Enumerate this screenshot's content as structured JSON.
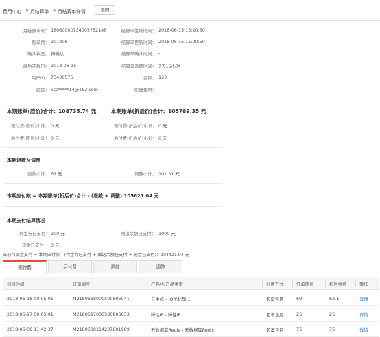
{
  "breadcrumb": {
    "home": "费用中心",
    "sep": ">",
    "level2": "月结算单",
    "level3": "月结算单详情"
  },
  "back_label": "返回",
  "info": {
    "bill_no_label": "月结算单号：",
    "bill_no": "18060000734005752146",
    "gen_time_label": "结算单生成时间：",
    "gen_time": "2018-06-15 15:20:50",
    "period_label": "账单月：",
    "period": "201806",
    "update_time_label": "结算单更新时间：",
    "update_time": "2018-06-15 15:20:50",
    "confirm_status_label": "确认状态：",
    "confirm_status": "待确认",
    "confirm_time_label": "结算单确认时间：",
    "confirm_time": "-",
    "due_date_label": "最后还款日：",
    "due_date": "2018-06-15",
    "overdue_label": "结算单逾期时间：",
    "overdue": "7天15小时",
    "user_id_label": "用户ID：",
    "user_id": "73400575",
    "name_label": "名称：",
    "name": "123",
    "email_label": "邮箱：",
    "email": "ksc*****14@163.com",
    "group_label": "所属集团：",
    "group": ""
  },
  "bill": {
    "orig_label": "本期账单(原价)合计：",
    "orig_value": "108735.74 元",
    "disc_label": "本期账单(折后价)合计：",
    "disc_value": "105789.35 元",
    "prepaid_orig_label": "预付费(原价)小计：",
    "prepaid_orig": "0 元",
    "prepaid_disc_label": "预付费(折后价)小计：",
    "prepaid_disc": "0 元",
    "postpaid_orig_label": "后付费(原价)小计：",
    "postpaid_orig": "0 元",
    "postpaid_disc_label": "后付费(折后价)小计：",
    "postpaid_disc": "0 元"
  },
  "refund": {
    "title": "本期退款及调整",
    "refund_label": "退款小计：",
    "refund_value": "67 元",
    "adjust_label": "调整小计：",
    "adjust_value": "101.31 元"
  },
  "payable": {
    "text": "本期应付款 = 本期账单(折后价)合计 - (退款 + 调整) 105621.04 元"
  },
  "settle": {
    "title": "本期支付结算情况",
    "voucher_label": "代金券已支付：",
    "voucher_value": "200 元",
    "gift_label": "赠送余额已支付：",
    "gift_value": "1000 元",
    "cash_label": "现金已支付：",
    "cash_value": "0 元",
    "formula": "当前待现金支付 = 本期应付款 - (代金券已支付 + 赠送余额已支付 + 现金已支付)：104421.04 元"
  },
  "tabs": [
    "预付费",
    "后付费",
    "退款",
    "调整"
  ],
  "table": {
    "headers": [
      "创建时间",
      "订单编号",
      "产品线/产品类型",
      "计费方式",
      "订单原价",
      "折后金额",
      "操作"
    ],
    "rows": [
      [
        "2018-06-18 00:05:01",
        "M2180618000500805041",
        "云主机 - IO优化型I1",
        "包年包月",
        "69",
        "62.1",
        "详情"
      ],
      [
        "2018-06-17 00:05:01",
        "M2180617000500805033",
        "弹性IP - 弹性IP",
        "包年包月",
        "25",
        "25",
        "详情"
      ],
      [
        "2018-06-08 11:42:37",
        "M2180608114237801989",
        "云数据库Redis - 云数据库Redis",
        "包年包月",
        "75",
        "75",
        "详情"
      ]
    ]
  },
  "colors": {
    "accent": "#e74c3c",
    "link": "#2b84d6"
  }
}
